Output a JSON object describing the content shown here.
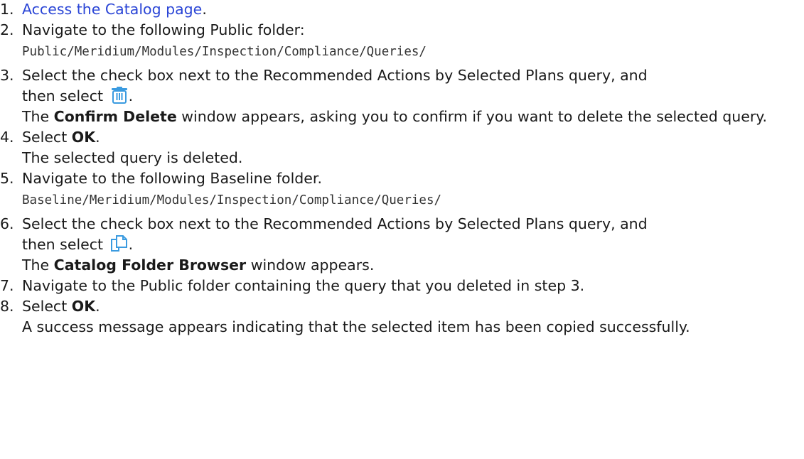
{
  "steps": [
    {
      "num": "1.",
      "link": "Access the Catalog page",
      "after": "."
    },
    {
      "num": "2.",
      "text": "Navigate to the following Public folder:",
      "path": "Public/Meridium/Modules/Inspection/Compliance/Queries/"
    },
    {
      "num": "3.",
      "text": "Select the check box next to the Recommended Actions by Selected Plans query, and",
      "text2": "then select",
      "after_icon": ".",
      "icon": "trash-icon",
      "result_pre": "The ",
      "result_bold": "Confirm Delete",
      "result_post": " window appears, asking you to confirm if you want to delete the selected query."
    },
    {
      "num": "4.",
      "pre": "Select ",
      "bold": "OK",
      "post": ".",
      "result": "The selected query is deleted."
    },
    {
      "num": "5.",
      "text": "Navigate to the following Baseline folder.",
      "path": "Baseline/Meridium/Modules/Inspection/Compliance/Queries/"
    },
    {
      "num": "6.",
      "text": "Select the check box next to the Recommended Actions by Selected Plans query, and",
      "text2": "then select",
      "after_icon": ".",
      "icon": "copy-icon",
      "result_pre": "The ",
      "result_bold": "Catalog Folder Browser",
      "result_post": " window appears."
    },
    {
      "num": "7.",
      "text": "Navigate to the Public folder containing the query that you deleted in step 3."
    },
    {
      "num": "8.",
      "pre": "Select ",
      "bold": "OK",
      "post": ".",
      "result": "A success message appears indicating that the selected item has been copied successfully."
    }
  ],
  "colors": {
    "link": "#2a45d6",
    "icon": "#3b9be0"
  }
}
